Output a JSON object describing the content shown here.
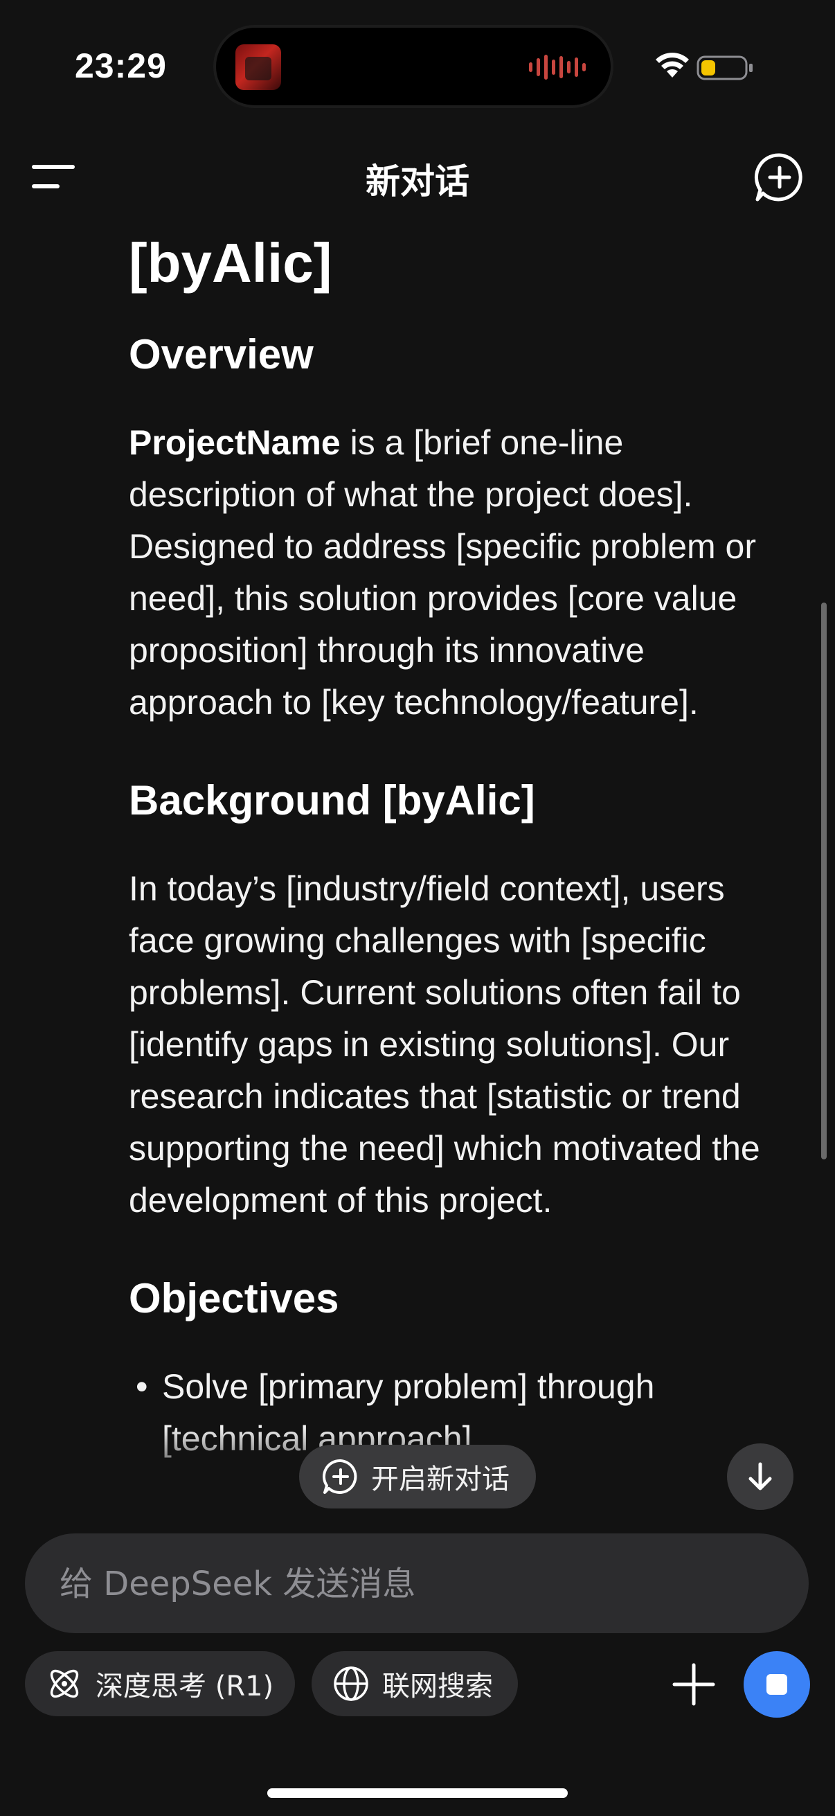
{
  "status_bar": {
    "time": "23:29",
    "battery_color": "#f5c400"
  },
  "nav": {
    "title": "新对话",
    "menu_icon": "menu-icon",
    "new_chat_icon": "new-chat-icon"
  },
  "content": {
    "title": "[byAlic]",
    "overview_heading": "Overview",
    "overview_bold": "ProjectName",
    "overview_text": " is a [brief one-line description of what the project does]. Designed to address [specific problem or need], this solution provides [core value proposition] through its innovative approach to [key technology/feature].",
    "background_heading": "Background [byAlic]",
    "background_text": "In today’s [industry/field context], users face growing challenges with [specific problems]. Current solutions often fail to [identify gaps in existing solutions]. Our research indicates that [statistic or trend supporting the need] which motivated the development of this project.",
    "objectives_heading": "Objectives",
    "objectives": [
      "Solve [primary problem] through [technical approach]"
    ]
  },
  "floating": {
    "new_chat_label": "开启新对话",
    "scroll_down_icon": "arrow-down-icon"
  },
  "input": {
    "placeholder": "给 DeepSeek 发送消息",
    "value": ""
  },
  "toolbar": {
    "deep_think_label": "深度思考 (R1)",
    "web_search_label": "联网搜索",
    "plus_icon": "plus-icon",
    "stop_icon": "stop-icon"
  },
  "colors": {
    "background": "#121212",
    "accent": "#3b82f6",
    "surface": "#2c2c2e"
  }
}
